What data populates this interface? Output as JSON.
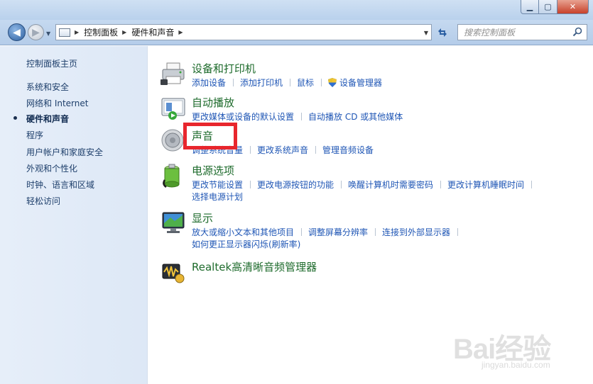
{
  "window": {
    "minimize_glyph": "▁",
    "maximize_glyph": "▢",
    "close_glyph": "✕"
  },
  "navbar": {
    "back_glyph": "◀",
    "forward_glyph": "▶",
    "breadcrumb": [
      "控制面板",
      "硬件和声音"
    ],
    "search_placeholder": "搜索控制面板"
  },
  "sidebar": {
    "items": [
      {
        "label": "控制面板主页",
        "active": false
      },
      {
        "label": "系统和安全",
        "active": false
      },
      {
        "label": "网络和 Internet",
        "active": false
      },
      {
        "label": "硬件和声音",
        "active": true
      },
      {
        "label": "程序",
        "active": false
      },
      {
        "label": "用户帐户和家庭安全",
        "active": false
      },
      {
        "label": "外观和个性化",
        "active": false
      },
      {
        "label": "时钟、语言和区域",
        "active": false
      },
      {
        "label": "轻松访问",
        "active": false
      }
    ]
  },
  "categories": [
    {
      "title": "设备和打印机",
      "icon": "printer-icon",
      "links": [
        "添加设备",
        "添加打印机",
        "鼠标",
        "设备管理器"
      ]
    },
    {
      "title": "自动播放",
      "icon": "autoplay-icon",
      "links": [
        "更改媒体或设备的默认设置",
        "自动播放 CD 或其他媒体"
      ]
    },
    {
      "title": "声音",
      "icon": "speaker-icon",
      "links": [
        "调整系统音量",
        "更改系统声音",
        "管理音频设备"
      ]
    },
    {
      "title": "电源选项",
      "icon": "battery-icon",
      "links": [
        "更改节能设置",
        "更改电源按钮的功能",
        "唤醒计算机时需要密码",
        "更改计算机睡眠时间",
        "选择电源计划"
      ]
    },
    {
      "title": "显示",
      "icon": "monitor-icon",
      "links": [
        "放大或缩小文本和其他项目",
        "调整屏幕分辨率",
        "连接到外部显示器",
        "如何更正显示器闪烁(刷新率)"
      ]
    },
    {
      "title": "Realtek高清晰音频管理器",
      "icon": "realtek-audio-icon",
      "links": []
    }
  ],
  "watermark": {
    "brand": "Bai经验",
    "url": "jingyan.baidu.com"
  },
  "colors": {
    "category_title": "#1e6b2c",
    "link": "#1f56b5",
    "highlight_box": "#e8262d"
  }
}
